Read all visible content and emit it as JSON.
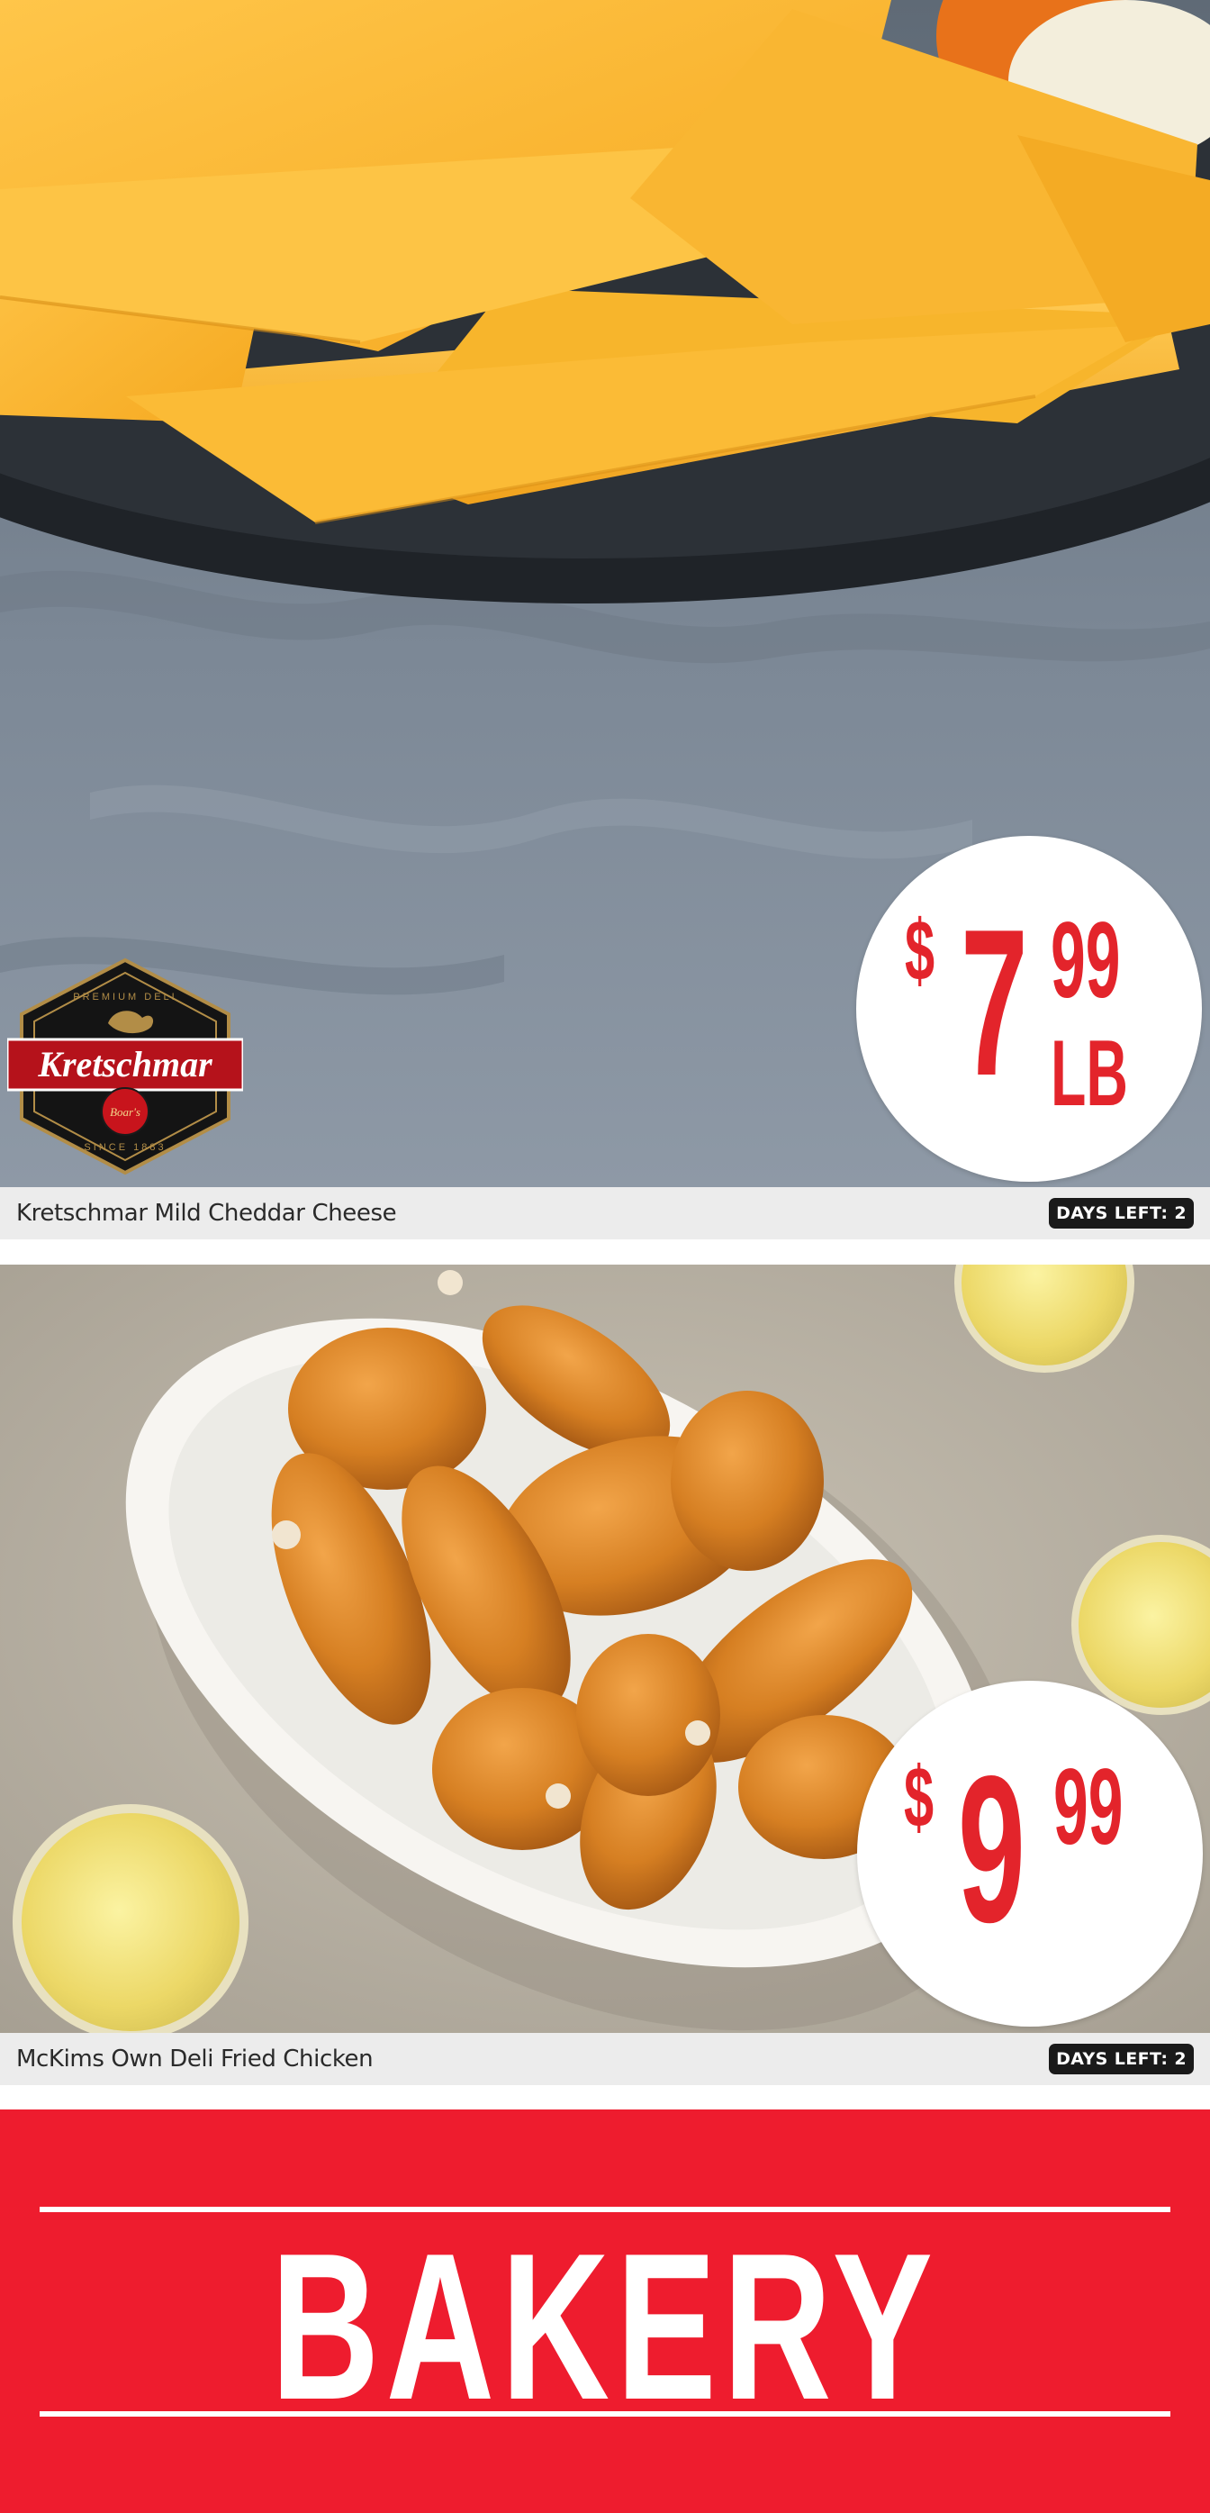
{
  "products": [
    {
      "name": "Kretschmar Mild Cheddar Cheese",
      "days_left_label": "DAYS LEFT: 2",
      "price": {
        "dollar_sign": "$",
        "dollars": "7",
        "cents": "99",
        "unit": "LB"
      },
      "brand_logo": {
        "top_text": "PREMIUM DELI",
        "name": "Kretschmar",
        "seal_text": "Boar's",
        "bottom_text": "SINCE 1883"
      }
    },
    {
      "name": "McKims Own Deli Fried Chicken",
      "days_left_label": "DAYS LEFT: 2",
      "price": {
        "dollar_sign": "$",
        "dollars": "9",
        "cents": "99"
      }
    }
  ],
  "section_banner": {
    "title": "BAKERY"
  },
  "colors": {
    "price_red": "#e3242b",
    "banner_red": "#ee1c2e",
    "caption_bg": "#ececec",
    "badge_bg": "#1a1a1a"
  }
}
